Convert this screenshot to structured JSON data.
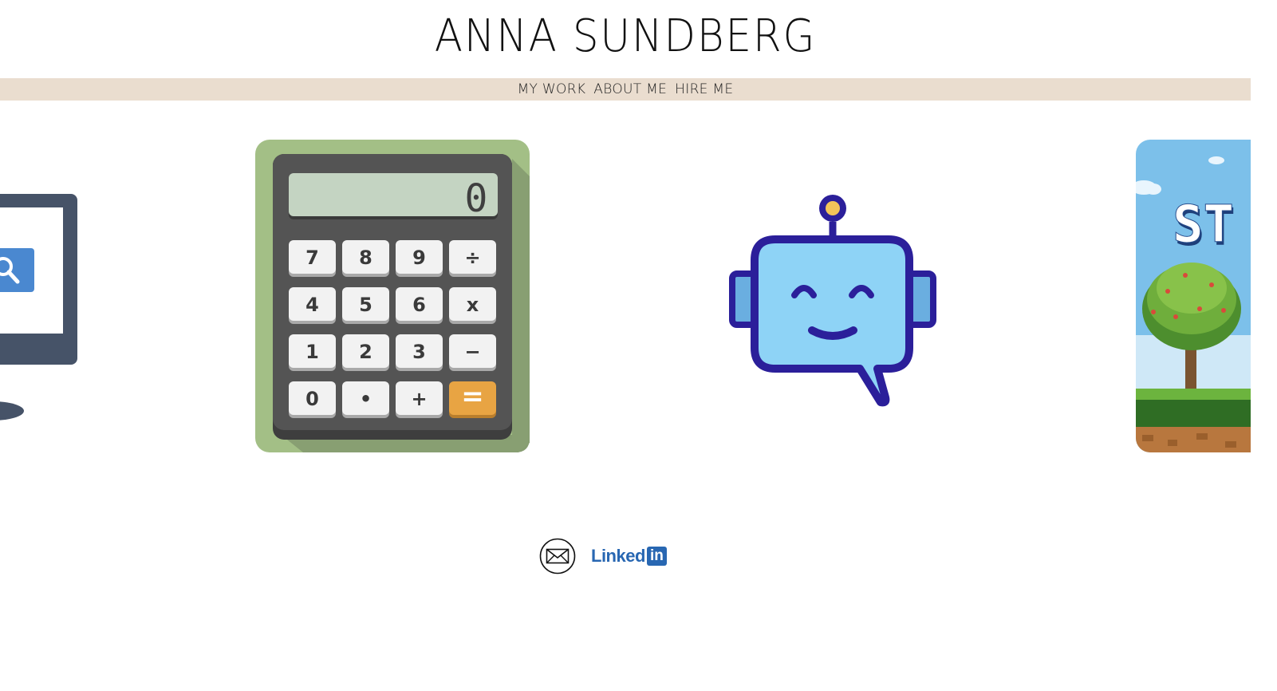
{
  "header": {
    "title": "ANNA SUNDBERG"
  },
  "nav": {
    "items": [
      {
        "label": "MY WORK"
      },
      {
        "label": "ABOUT ME"
      },
      {
        "label": "HIRE ME"
      }
    ]
  },
  "projects": [
    {
      "icon": "monitor-search-icon"
    },
    {
      "icon": "calculator-icon",
      "display": "0",
      "keys": [
        "7",
        "8",
        "9",
        "÷",
        "4",
        "5",
        "6",
        "x",
        "1",
        "2",
        "3",
        "−",
        "0",
        "•",
        "+",
        "="
      ]
    },
    {
      "icon": "chatbot-icon"
    },
    {
      "icon": "pixel-game-icon",
      "title_fragment": "ST"
    }
  ],
  "footer": {
    "email_icon": "envelope-icon",
    "linkedin": {
      "word": "Linked",
      "badge": "in"
    }
  },
  "colors": {
    "nav_background": "#eaddcf",
    "linkedin_blue": "#2867b2",
    "calculator_green": "#a3bf86",
    "robot_body": "#8ed3f6",
    "robot_outline": "#2b1f9a",
    "equals_key": "#e8a443"
  }
}
